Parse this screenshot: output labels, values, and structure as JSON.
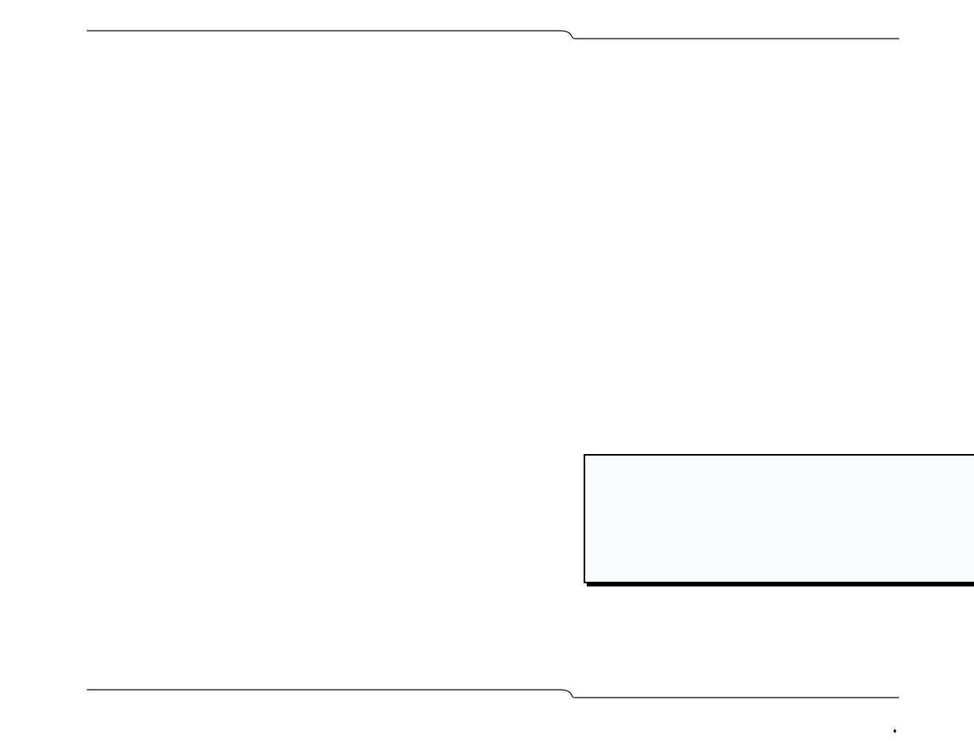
{
  "callout": {
    "text": ""
  },
  "footer": {
    "left": "",
    "separator": "♦",
    "page_number": ""
  }
}
